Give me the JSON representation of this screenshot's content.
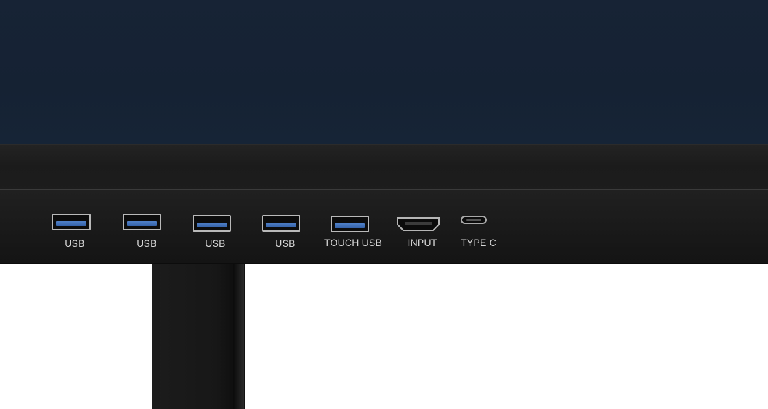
{
  "panel": {
    "ports": [
      {
        "kind": "usb",
        "label": "USB"
      },
      {
        "kind": "usb",
        "label": "USB"
      },
      {
        "kind": "usb",
        "label": "USB"
      },
      {
        "kind": "usb",
        "label": "USB"
      },
      {
        "kind": "usb",
        "label": "TOUCH  USB"
      },
      {
        "kind": "hdmi",
        "label": "INPUT"
      },
      {
        "kind": "type-c",
        "label": "TYPE  C"
      }
    ]
  },
  "colors": {
    "screen": "#162335",
    "bezel": "#1b1b1b",
    "usb_tongue_blue": "#3f6fb8",
    "label_text": "#d6d6d6",
    "background": "#ffffff"
  }
}
